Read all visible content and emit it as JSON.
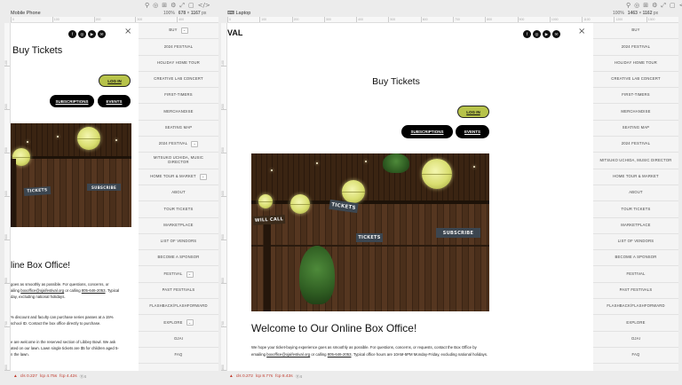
{
  "toolbar_icons": [
    "⚲",
    "◎",
    "⊞",
    "⚙",
    "⤢",
    "▢",
    "</>"
  ],
  "frames": {
    "mobile": {
      "title": "Mobile Phone",
      "zoom": "100%",
      "width_label": "678",
      "times": "×",
      "height_label": "1167",
      "unit": "px",
      "ruler_marks": [
        "0",
        "100",
        "200",
        "300",
        "400"
      ]
    },
    "laptop": {
      "title": "Laptop",
      "zoom": "100%",
      "width_label": "1463",
      "times": "×",
      "height_label": "1162",
      "unit": "px",
      "ruler_marks": [
        "0",
        "100",
        "200",
        "300",
        "400",
        "500",
        "600",
        "700",
        "800",
        "900",
        "1000",
        "1100",
        "1200",
        "1300"
      ]
    }
  },
  "vertical_ruler_marks": [
    "100",
    "200",
    "300",
    "400",
    "500",
    "600",
    "700",
    "800"
  ],
  "brand_suffix": "VAL",
  "social_icons": [
    "facebook-icon",
    "instagram-icon",
    "youtube-icon",
    "email-icon"
  ],
  "social_glyphs": [
    "f",
    "◎",
    "▶",
    "✉"
  ],
  "close_glyph": "×",
  "page": {
    "title": "Buy Tickets",
    "login_label": "LOG IN",
    "subscriptions_label": "SUBSCRIPTIONS",
    "events_label": "EVENTS",
    "welcome_heading": "Welcome to Our Online Box Office!",
    "mobile_heading": "line Box Office!",
    "photo_signs": {
      "tickets": "TICKETS",
      "subscribe": "SUBSCRIBE",
      "will_call": "WILL CALL",
      "small": "WILL CALL"
    }
  },
  "laptop_paragraph": {
    "p1_before": "We hope your ticket-buying experience goes as smoothly as possible. For questions, concerns, or requests, contact the Box Office by emailing ",
    "email": "boxoffice@ojaifestival.org",
    "p1_mid": " or calling ",
    "phone": "805-646-2053",
    "p1_after": ". Typical office hours are 10AM-5PM Monday-Friday, excluding national holidays."
  },
  "mobile_paragraphs": {
    "p1_a": "goes as smoothly as possible. For questions, concerns, or",
    "p1_b": "ailing ",
    "email": "boxoffice@ojaifestival.org",
    "p1_c": " or calling ",
    "phone": "805-646-2053",
    "p1_d": ". Typical",
    "p1_e": "day, excluding national holidays.",
    "p2_a": "% discount and faculty can purchase series passes at a 15%",
    "p2_b": " school ID. Contact the box office directly to purchase.",
    "p3_a": "e are welcome in the reserved section of Libbey Bowl. We ask",
    "p3_b": "ated on our lawn. Lawn single tickets are $5 for children aged 5-",
    "p3_c": "n the lawn."
  },
  "menu_items": [
    {
      "label": "BUY",
      "toggle": true
    },
    {
      "label": "2024 FESTIVAL",
      "toggle": false
    },
    {
      "label": "HOLIDAY HOME TOUR",
      "toggle": false
    },
    {
      "label": "CREATIVE LAB CONCERT",
      "toggle": false
    },
    {
      "label": "FIRST-TIMERS",
      "toggle": false
    },
    {
      "label": "MERCHANDISE",
      "toggle": false
    },
    {
      "label": "SEATING MAP",
      "toggle": false
    },
    {
      "label": "2024 FESTIVAL",
      "toggle": true
    },
    {
      "label": "MITSUKO UCHIDA, MUSIC DIRECTOR",
      "toggle": false
    },
    {
      "label": "HOME TOUR & MARKET",
      "toggle": true
    },
    {
      "label": "ABOUT",
      "toggle": false
    },
    {
      "label": "TOUR TICKETS",
      "toggle": false
    },
    {
      "label": "MARKETPLACE",
      "toggle": false
    },
    {
      "label": "LIST OF VENDORS",
      "toggle": false
    },
    {
      "label": "BECOME A SPONSOR",
      "toggle": false
    },
    {
      "label": "FESTIVAL",
      "toggle": true
    },
    {
      "label": "PAST FESTIVALS",
      "toggle": false
    },
    {
      "label": "FLASHBACK/FLASHFORWARD",
      "toggle": false
    },
    {
      "label": "EXPLORE",
      "toggle": true
    },
    {
      "label": "OJAI",
      "toggle": false
    },
    {
      "label": "FAQ",
      "toggle": false
    }
  ],
  "toggle_glyph": "⌄",
  "status": {
    "mobile": {
      "warn": "▲",
      "cls": "cls 0.227",
      "lcp": "lcp 4.75s",
      "fcp": "fcp 4.42s",
      "count": "⓪4"
    },
    "laptop": {
      "warn": "▲",
      "cls": "cls 0.272",
      "lcp": "lcp 8.77s",
      "fcp": "fcp 8.43s",
      "count": "⓪4"
    }
  }
}
